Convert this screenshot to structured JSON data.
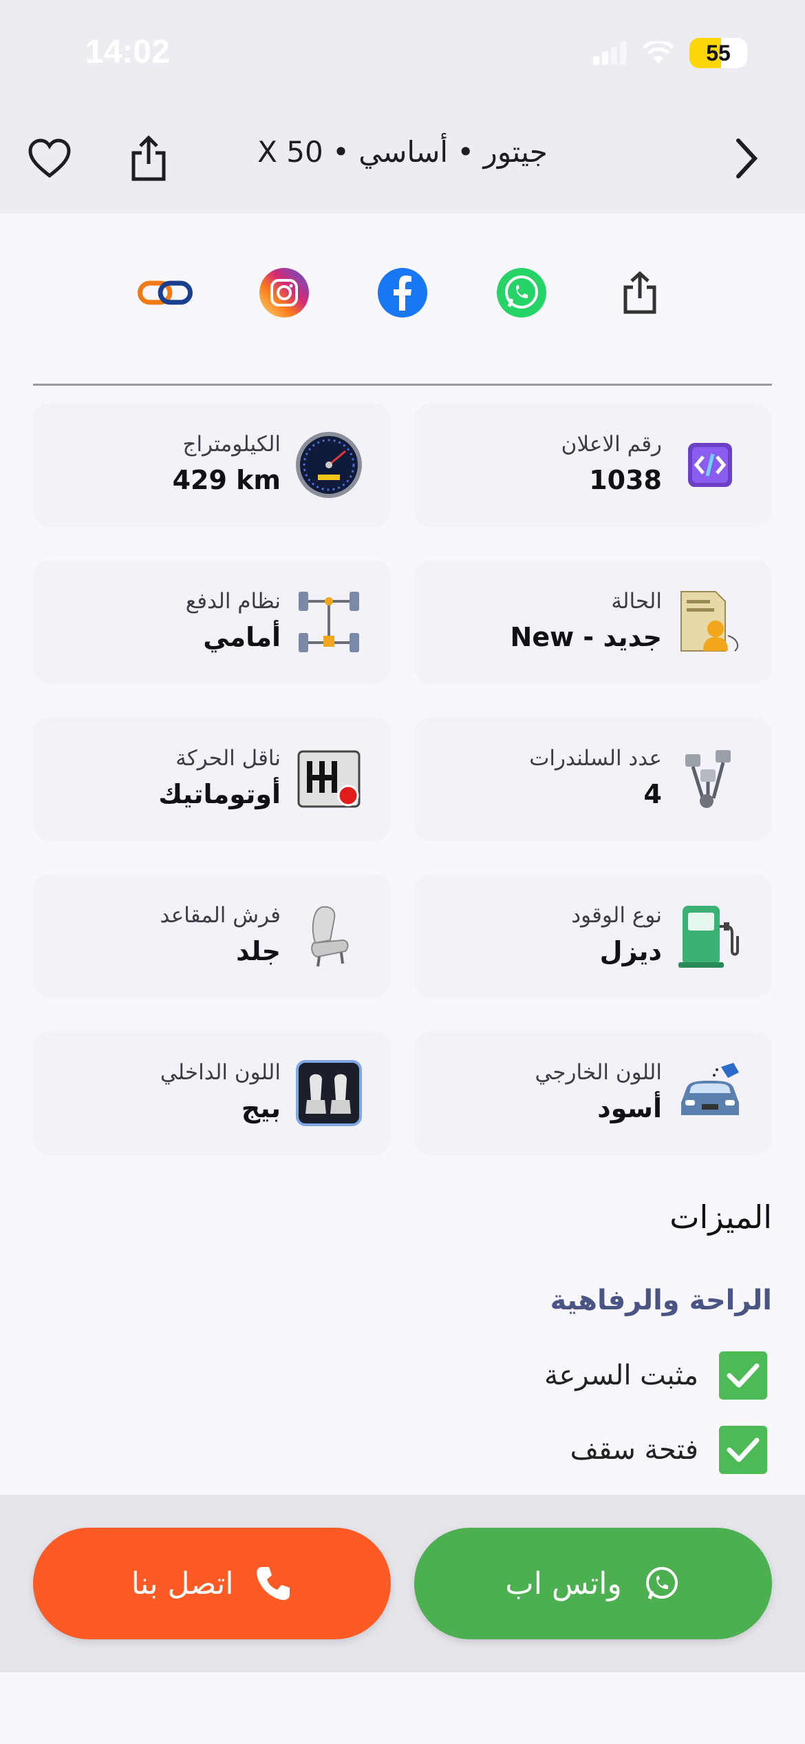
{
  "status_bar": {
    "time": "14:02",
    "battery": "55"
  },
  "header": {
    "title": "جيتور • أساسي • X 50"
  },
  "share": {
    "items": [
      "share",
      "whatsapp",
      "facebook",
      "instagram",
      "link"
    ]
  },
  "specs": [
    {
      "label": "رقم الاعلان",
      "value": "1038",
      "icon": "code-icon"
    },
    {
      "label": "الكيلومتراج",
      "value": "429 km",
      "icon": "speedometer-icon"
    },
    {
      "label": "الحالة",
      "value": "New - جديد",
      "icon": "condition-icon"
    },
    {
      "label": "نظام الدفع",
      "value": "أمامي",
      "icon": "drivetrain-icon"
    },
    {
      "label": "عدد السلندرات",
      "value": "4",
      "icon": "pistons-icon"
    },
    {
      "label": "ناقل الحركة",
      "value": "أوتوماتيك",
      "icon": "gearbox-icon"
    },
    {
      "label": "نوع الوقود",
      "value": "ديزل",
      "icon": "fuel-pump-icon"
    },
    {
      "label": "فرش المقاعد",
      "value": "جلد",
      "icon": "seat-icon"
    },
    {
      "label": "اللون الخارجي",
      "value": "أسود",
      "icon": "car-paint-icon"
    },
    {
      "label": "اللون الداخلي",
      "value": "بيج",
      "icon": "interior-seats-icon"
    }
  ],
  "features": {
    "title": "الميزات",
    "groups": [
      {
        "name": "الراحة والرفاهية",
        "items": [
          "مثبت السرعة",
          "فتحة سقف"
        ]
      }
    ]
  },
  "actions": {
    "whatsapp_label": "واتس اب",
    "call_label": "اتصل بنا"
  },
  "colors": {
    "whatsapp": "#4caf50",
    "call": "#fe5a25",
    "check": "#4cba55",
    "accent": "#4b5585"
  }
}
